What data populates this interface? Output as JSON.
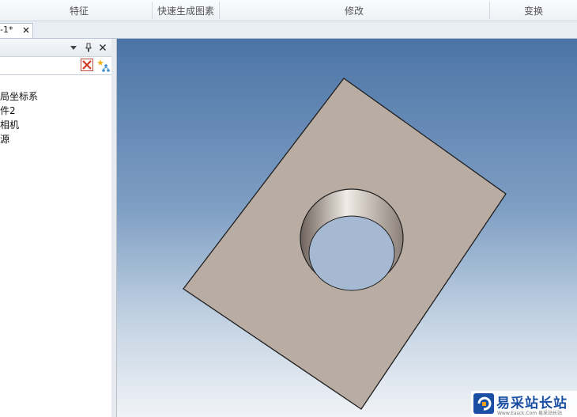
{
  "ribbon": {
    "groups": [
      "特征",
      "快速生成图素",
      "修改",
      "变换"
    ]
  },
  "document_tab": {
    "label": "-1*",
    "close_icon": "close-icon"
  },
  "panel": {
    "icons": [
      "dropdown-icon",
      "pin-icon",
      "close-icon"
    ],
    "toolbar_icons": [
      "delete-icon",
      "star-icon"
    ],
    "tree_items": [
      "局坐标系",
      "件2",
      "相机",
      "源"
    ]
  },
  "viewport": {
    "background_top": "#4b74a6",
    "background_bottom": "#f0f3f7",
    "part_color": "#b9aca3"
  },
  "watermark": {
    "title": "易采站长站",
    "subtitle": "Www.Easck.Com  易采站长站"
  }
}
